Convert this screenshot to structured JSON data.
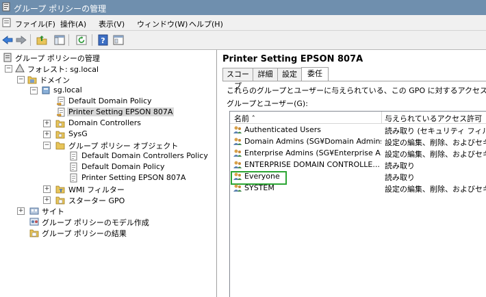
{
  "window": {
    "title": "グループ ポリシーの管理"
  },
  "menu": [
    "ファイル(F)",
    "操作(A)",
    "表示(V)",
    "ウィンドウ(W)",
    "ヘルプ(H)"
  ],
  "toolbar": {
    "icons": [
      "back-arrow-icon",
      "forward-arrow-icon",
      "up-folder-icon",
      "show-hide-tree-icon",
      "refresh-icon",
      "help-icon",
      "properties-icon"
    ]
  },
  "tree": {
    "root": "グループ ポリシーの管理",
    "forest": "フォレスト: sg.local",
    "domains": "ドメイン",
    "domain": "sg.local",
    "items": [
      "Default Domain Policy",
      "Printer Setting EPSON 807A",
      "Domain Controllers",
      "SysG",
      "グループ ポリシー オブジェクト",
      "Default Domain Controllers Policy",
      "Default Domain Policy",
      "Printer Setting EPSON 807A",
      "WMI フィルター",
      "スターター GPO"
    ],
    "sites": "サイト",
    "modeling": "グループ ポリシーのモデル作成",
    "results": "グループ ポリシーの結果"
  },
  "detail": {
    "title": "Printer Setting EPSON 807A",
    "tabs": [
      "スコープ",
      "詳細",
      "設定",
      "委任"
    ],
    "active_tab": "委任",
    "description": "これらのグループとユーザーに与えられている、この GPO に対するアクセス許",
    "group_label": "グループとユーザー(G):",
    "columns": [
      "名前 ˆ",
      "与えられているアクセス許可"
    ],
    "rows": [
      {
        "name": "Authenticated Users",
        "permission": "読み取り (セキュリティ フィルター"
      },
      {
        "name": "Domain Admins (SG¥Domain Admins)",
        "permission": "設定の編集、削除、およびセキ"
      },
      {
        "name": "Enterprise Admins (SG¥Enterprise A...",
        "permission": "設定の編集、削除、およびセキ"
      },
      {
        "name": "ENTERPRISE DOMAIN CONTROLLE...",
        "permission": "読み取り"
      },
      {
        "name": "Everyone",
        "permission": "読み取り"
      },
      {
        "name": "SYSTEM",
        "permission": "設定の編集、削除、およびセキ"
      }
    ],
    "highlight_color": "#2aa532"
  }
}
